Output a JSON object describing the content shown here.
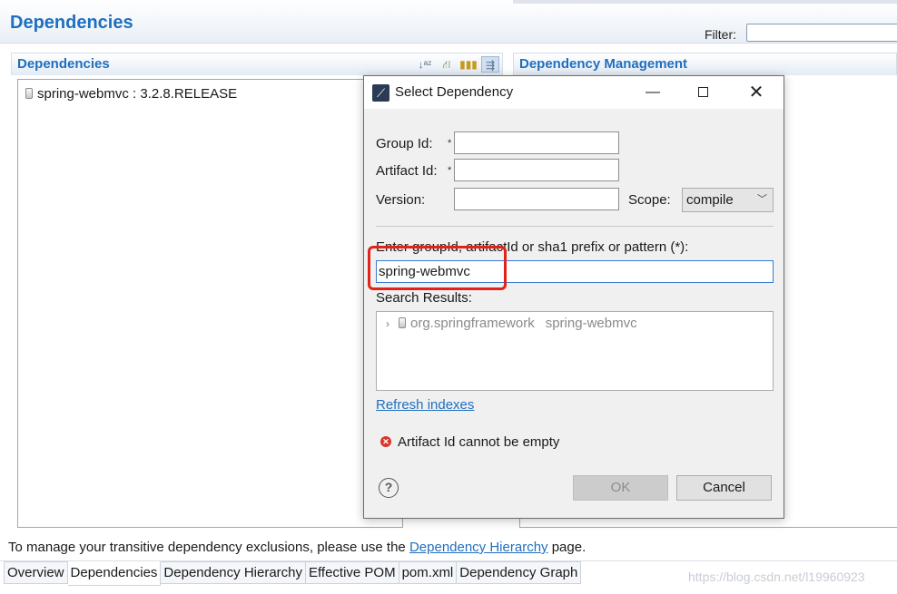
{
  "editor": {
    "title": "Dependencies",
    "filter_label": "Filter:",
    "filter_value": ""
  },
  "dependencies_section": {
    "title": "Dependencies",
    "toolbar_icons": [
      "sort-alphabetically-icon",
      "show-group-id-icon",
      "columns-icon",
      "toggle-icon"
    ],
    "items": [
      {
        "label": "spring-webmvc : 3.2.8.RELEASE",
        "icon": "jar-icon"
      }
    ]
  },
  "management_section": {
    "title": "Dependency Management"
  },
  "footer": {
    "note_before": "To manage your transitive dependency exclusions, please use the",
    "note_link": "Dependency Hierarchy",
    "note_after": "page."
  },
  "bottom_tabs": [
    {
      "label": "Overview",
      "active": false
    },
    {
      "label": "Dependencies",
      "active": true
    },
    {
      "label": "Dependency Hierarchy",
      "active": false
    },
    {
      "label": "Effective POM",
      "active": false
    },
    {
      "label": "pom.xml",
      "active": false
    },
    {
      "label": "Dependency Graph",
      "active": false
    }
  ],
  "watermark": "https://blog.csdn.net/l19960923",
  "dialog": {
    "title": "Select Dependency",
    "group_id_label": "Group Id:",
    "group_id_value": "",
    "artifact_id_label": "Artifact Id:",
    "artifact_id_value": "",
    "required_marker": "*",
    "version_label": "Version:",
    "version_value": "",
    "scope_label": "Scope:",
    "scope_value": "compile",
    "pattern_label": "Enter groupId, artifactId or sha1 prefix or pattern (*):",
    "pattern_value": "spring-webmvc",
    "results_label": "Search Results:",
    "results": [
      {
        "group": "org.springframework",
        "artifact": "spring-webmvc"
      }
    ],
    "refresh_link": "Refresh indexes",
    "error_message": "Artifact Id cannot be empty",
    "ok_label": "OK",
    "cancel_label": "Cancel",
    "highlight_color": "#e0241b"
  }
}
